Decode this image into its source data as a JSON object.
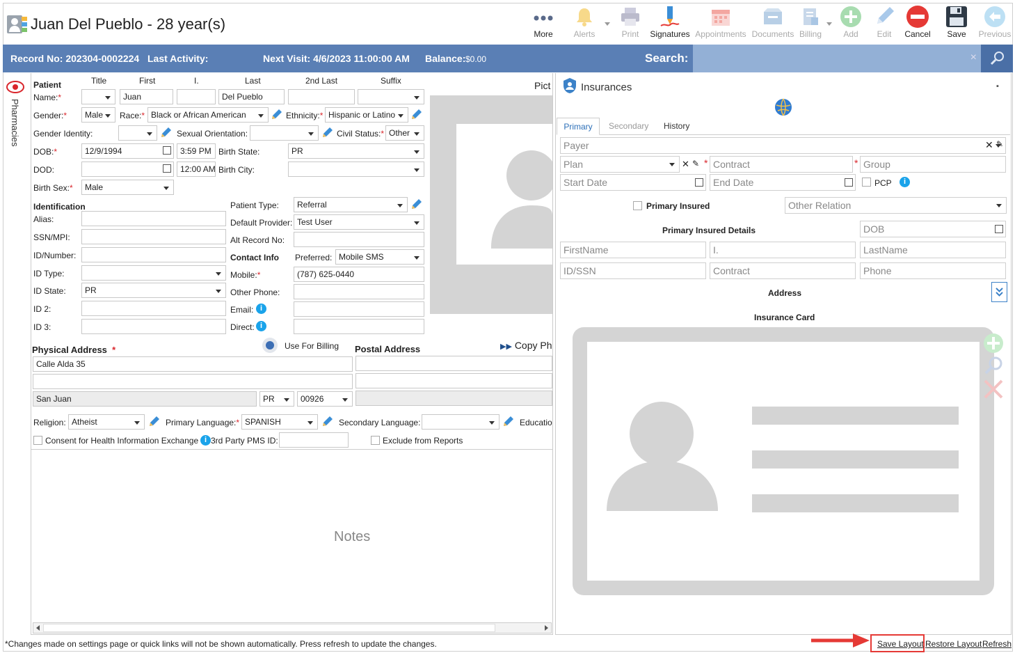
{
  "header": {
    "title": "Juan Del Pueblo - 28 year(s)",
    "toolbar": [
      {
        "label": "More",
        "icon": "more-dots-icon",
        "enabled": true
      },
      {
        "label": "Alerts",
        "icon": "bell-icon",
        "enabled": false
      },
      {
        "label": "Print",
        "icon": "printer-icon",
        "enabled": false
      },
      {
        "label": "Signatures",
        "icon": "signature-pen-icon",
        "enabled": true
      },
      {
        "label": "Appointments",
        "icon": "calendar-icon",
        "enabled": false
      },
      {
        "label": "Documents",
        "icon": "documents-icon",
        "enabled": false
      },
      {
        "label": "Billing",
        "icon": "billing-icon",
        "enabled": false
      },
      {
        "label": "Add",
        "icon": "add-icon",
        "enabled": false
      },
      {
        "label": "Edit",
        "icon": "edit-icon",
        "enabled": false
      },
      {
        "label": "Cancel",
        "icon": "cancel-icon",
        "enabled": true
      },
      {
        "label": "Save",
        "icon": "save-icon",
        "enabled": true
      },
      {
        "label": "Previous",
        "icon": "previous-icon",
        "enabled": false
      }
    ]
  },
  "infobar": {
    "record": "Record No: 202304-0002224",
    "last_activity": "Last Activity:",
    "next_visit": "Next Visit: 4/6/2023 11:00:00 AM",
    "balance_label": "Balance:",
    "balance_value": "$0.00",
    "search_label": "Search:",
    "search_clear": "×"
  },
  "side_tab": {
    "label": "Pharmacies"
  },
  "patient": {
    "section": "Patient",
    "col_title": "Title",
    "col_first": "First",
    "col_initial": "I.",
    "col_last": "Last",
    "col_2nd_last": "2nd Last",
    "col_suffix": "Suffix",
    "name_label": "Name:",
    "first": "Juan",
    "last": "Del Pueblo",
    "gender_label": "Gender:",
    "gender": "Male",
    "race_label": "Race:",
    "race": "Black or African American",
    "ethnicity_label": "Ethnicity:",
    "ethnicity": "Hispanic or Latino",
    "gender_identity_label": "Gender Identity:",
    "sexual_orientation_label": "Sexual Orientation:",
    "civil_status_label": "Civil Status:",
    "civil_status": "Other",
    "dob_label": "DOB:",
    "dob": "12/9/1994",
    "dob_time": "3:59 PM",
    "birth_state_label": "Birth State:",
    "birth_state": "PR",
    "dod_label": "DOD:",
    "dod_time": "12:00 AM",
    "birth_city_label": "Birth City:",
    "birth_sex_label": "Birth Sex:",
    "birth_sex": "Male",
    "picture_label": "Pict"
  },
  "identification": {
    "section": "Identification",
    "alias_label": "Alias:",
    "ssn_label": "SSN/MPI:",
    "idnum_label": "ID/Number:",
    "idtype_label": "ID Type:",
    "idstate_label": "ID State:",
    "idstate": "PR",
    "id2_label": "ID 2:",
    "id3_label": "ID 3:",
    "patient_type_label": "Patient Type:",
    "patient_type": "Referral",
    "default_provider_label": "Default Provider:",
    "default_provider": "Test User",
    "alt_record_label": "Alt Record No:",
    "contact_info": "Contact Info",
    "preferred_label": "Preferred:",
    "preferred": "Mobile SMS",
    "mobile_label": "Mobile:",
    "mobile": "(787) 625-0440",
    "other_phone_label": "Other Phone:",
    "email_label": "Email:",
    "direct_label": "Direct:"
  },
  "address": {
    "physical": "Physical Address",
    "use_for_billing": "Use For Billing",
    "postal": "Postal Address",
    "copy": "Copy Ph",
    "line1": "Calle Alda 35",
    "city": "San Juan",
    "state": "PR",
    "zip": "00926"
  },
  "misc": {
    "religion_label": "Religion:",
    "religion": "Atheist",
    "primary_language_label": "Primary Language:",
    "primary_language": "SPANISH",
    "secondary_language_label": "Secondary Language:",
    "education_label": "Educatio",
    "consent_label": "Consent for Health Information Exchange",
    "pms_label": "3rd Party PMS ID:",
    "exclude_label": "Exclude from Reports",
    "notes_placeholder": "Notes"
  },
  "insurances": {
    "title": "Insurances",
    "tabs": [
      "Primary",
      "Secondary",
      "History"
    ],
    "payer": "Payer",
    "plan": "Plan",
    "contract": "Contract",
    "group": "Group",
    "start_date": "Start Date",
    "end_date": "End Date",
    "pcp": "PCP",
    "primary_insured": "Primary Insured",
    "other_relation": "Other Relation",
    "details": "Primary Insured Details",
    "dob": "DOB",
    "firstname": "FirstName",
    "initial": "I.",
    "lastname": "LastName",
    "id_ssn": "ID/SSN",
    "contract2": "Contract",
    "phone": "Phone",
    "address": "Address",
    "card": "Insurance Card"
  },
  "footer": {
    "note": "*Changes made on settings page or quick links will not be shown automatically. Press refresh to update the changes.",
    "save_layout": "Save Layout",
    "restore_layout": "Restore Layout",
    "refresh": "Refresh"
  },
  "colors": {
    "accent": "#5a7fb5",
    "required": "#d9262c",
    "info": "#1aa3ea",
    "highlight": "#e53935"
  }
}
